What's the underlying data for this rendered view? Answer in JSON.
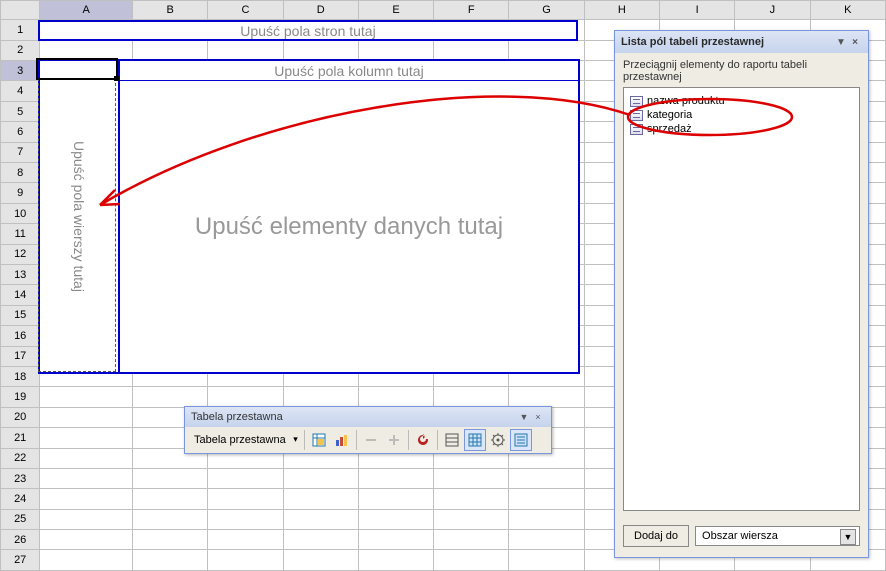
{
  "columns": [
    "A",
    "B",
    "C",
    "D",
    "E",
    "F",
    "G",
    "H",
    "I",
    "J",
    "K"
  ],
  "rows": [
    "1",
    "2",
    "3",
    "4",
    "5",
    "6",
    "7",
    "8",
    "9",
    "10",
    "11",
    "12",
    "13",
    "14",
    "15",
    "16",
    "17",
    "18",
    "19",
    "20",
    "21",
    "22",
    "23",
    "24",
    "25",
    "26",
    "27"
  ],
  "pivot": {
    "drop_page": "Upuść pola stron tutaj",
    "drop_cols": "Upuść pola kolumn tutaj",
    "drop_rows": "Upuść pola wierszy tutaj",
    "drop_data": "Upuść elementy danych tutaj"
  },
  "toolbar": {
    "title": "Tabela przestawna",
    "menu_label": "Tabela przestawna"
  },
  "fieldlist": {
    "title": "Lista pól tabeli przestawnej",
    "subtitle": "Przeciągnij elementy do raportu tabeli przestawnej",
    "fields": [
      "nazwa produktu",
      "kategoria",
      "sprzedaż"
    ],
    "add_button": "Dodaj do",
    "area_selected": "Obszar wiersza"
  }
}
